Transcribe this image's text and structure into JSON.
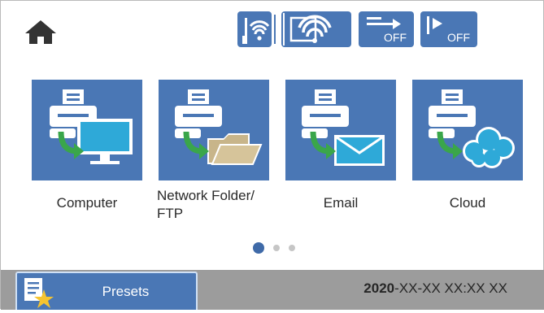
{
  "header": {
    "icons": [
      "home-icon",
      "wifi-wired-status-icon",
      "wifi-status-icon",
      "wifi-direct-off-icon",
      "direct-print-off-icon"
    ],
    "wifi_direct_state": "OFF",
    "direct_state": "OFF"
  },
  "tiles": [
    {
      "label": "Computer",
      "icon": "computer-icon"
    },
    {
      "label_line1": "Network Folder/",
      "label_line2": "FTP",
      "icon": "network-folder-icon"
    },
    {
      "label": "Email",
      "icon": "email-icon"
    },
    {
      "label": "Cloud",
      "icon": "cloud-icon"
    }
  ],
  "pagination": {
    "total": 3,
    "current": 1
  },
  "bottom_bar": {
    "presets_label": "Presets",
    "datetime_year": "2020",
    "datetime_rest": "-XX-XX XX:XX XX"
  },
  "colors": {
    "accent": "#4a77b5",
    "bar": "#9c9c9c",
    "arrow": "#3aa64a",
    "screen": "#2ea9d8"
  }
}
